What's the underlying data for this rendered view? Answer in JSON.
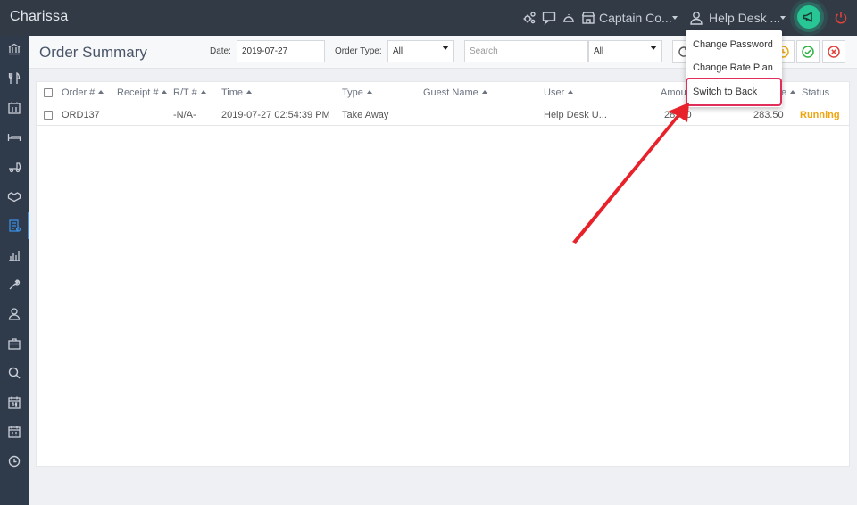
{
  "app": {
    "brand": "Charissa"
  },
  "topbar": {
    "restaurant": "Captain Co...",
    "user": "Help Desk ...",
    "icons": [
      "settings-cluster-icon",
      "chat-icon",
      "cloche-icon",
      "store-icon",
      "user-icon",
      "megaphone-icon",
      "power-icon"
    ]
  },
  "header": {
    "title": "Order Summary",
    "date_label": "Date:",
    "date_value": "2019-07-27",
    "order_type_label": "Order Type:",
    "order_type_value": "All",
    "search_placeholder": "Search",
    "filter_value": "All"
  },
  "dropdown": {
    "items": [
      {
        "label": "Change Password"
      },
      {
        "label": "Change Rate Plan"
      },
      {
        "label": "Switch to Back"
      }
    ],
    "highlighted": "Switch to Back"
  },
  "table": {
    "columns": [
      "Order #",
      "Receipt #",
      "R/T #",
      "Time",
      "Type",
      "Guest Name",
      "User",
      "Amou",
      "e",
      "Status"
    ],
    "rows": [
      {
        "order": "ORD137",
        "receipt": "",
        "rt": "-N/A-",
        "time": "2019-07-27 02:54:39 PM",
        "type": "Take Away",
        "guest": "",
        "user": "Help Desk U...",
        "amount": "28 .50",
        "total": "283.50",
        "status": "Running"
      }
    ]
  },
  "colors": {
    "topbar": "#323a46",
    "sidebar": "#2f3a4b",
    "accent_green": "#27c694",
    "status_running": "#f0a30a",
    "annotation_red": "#e02d5a",
    "power_red": "#e0423a"
  }
}
